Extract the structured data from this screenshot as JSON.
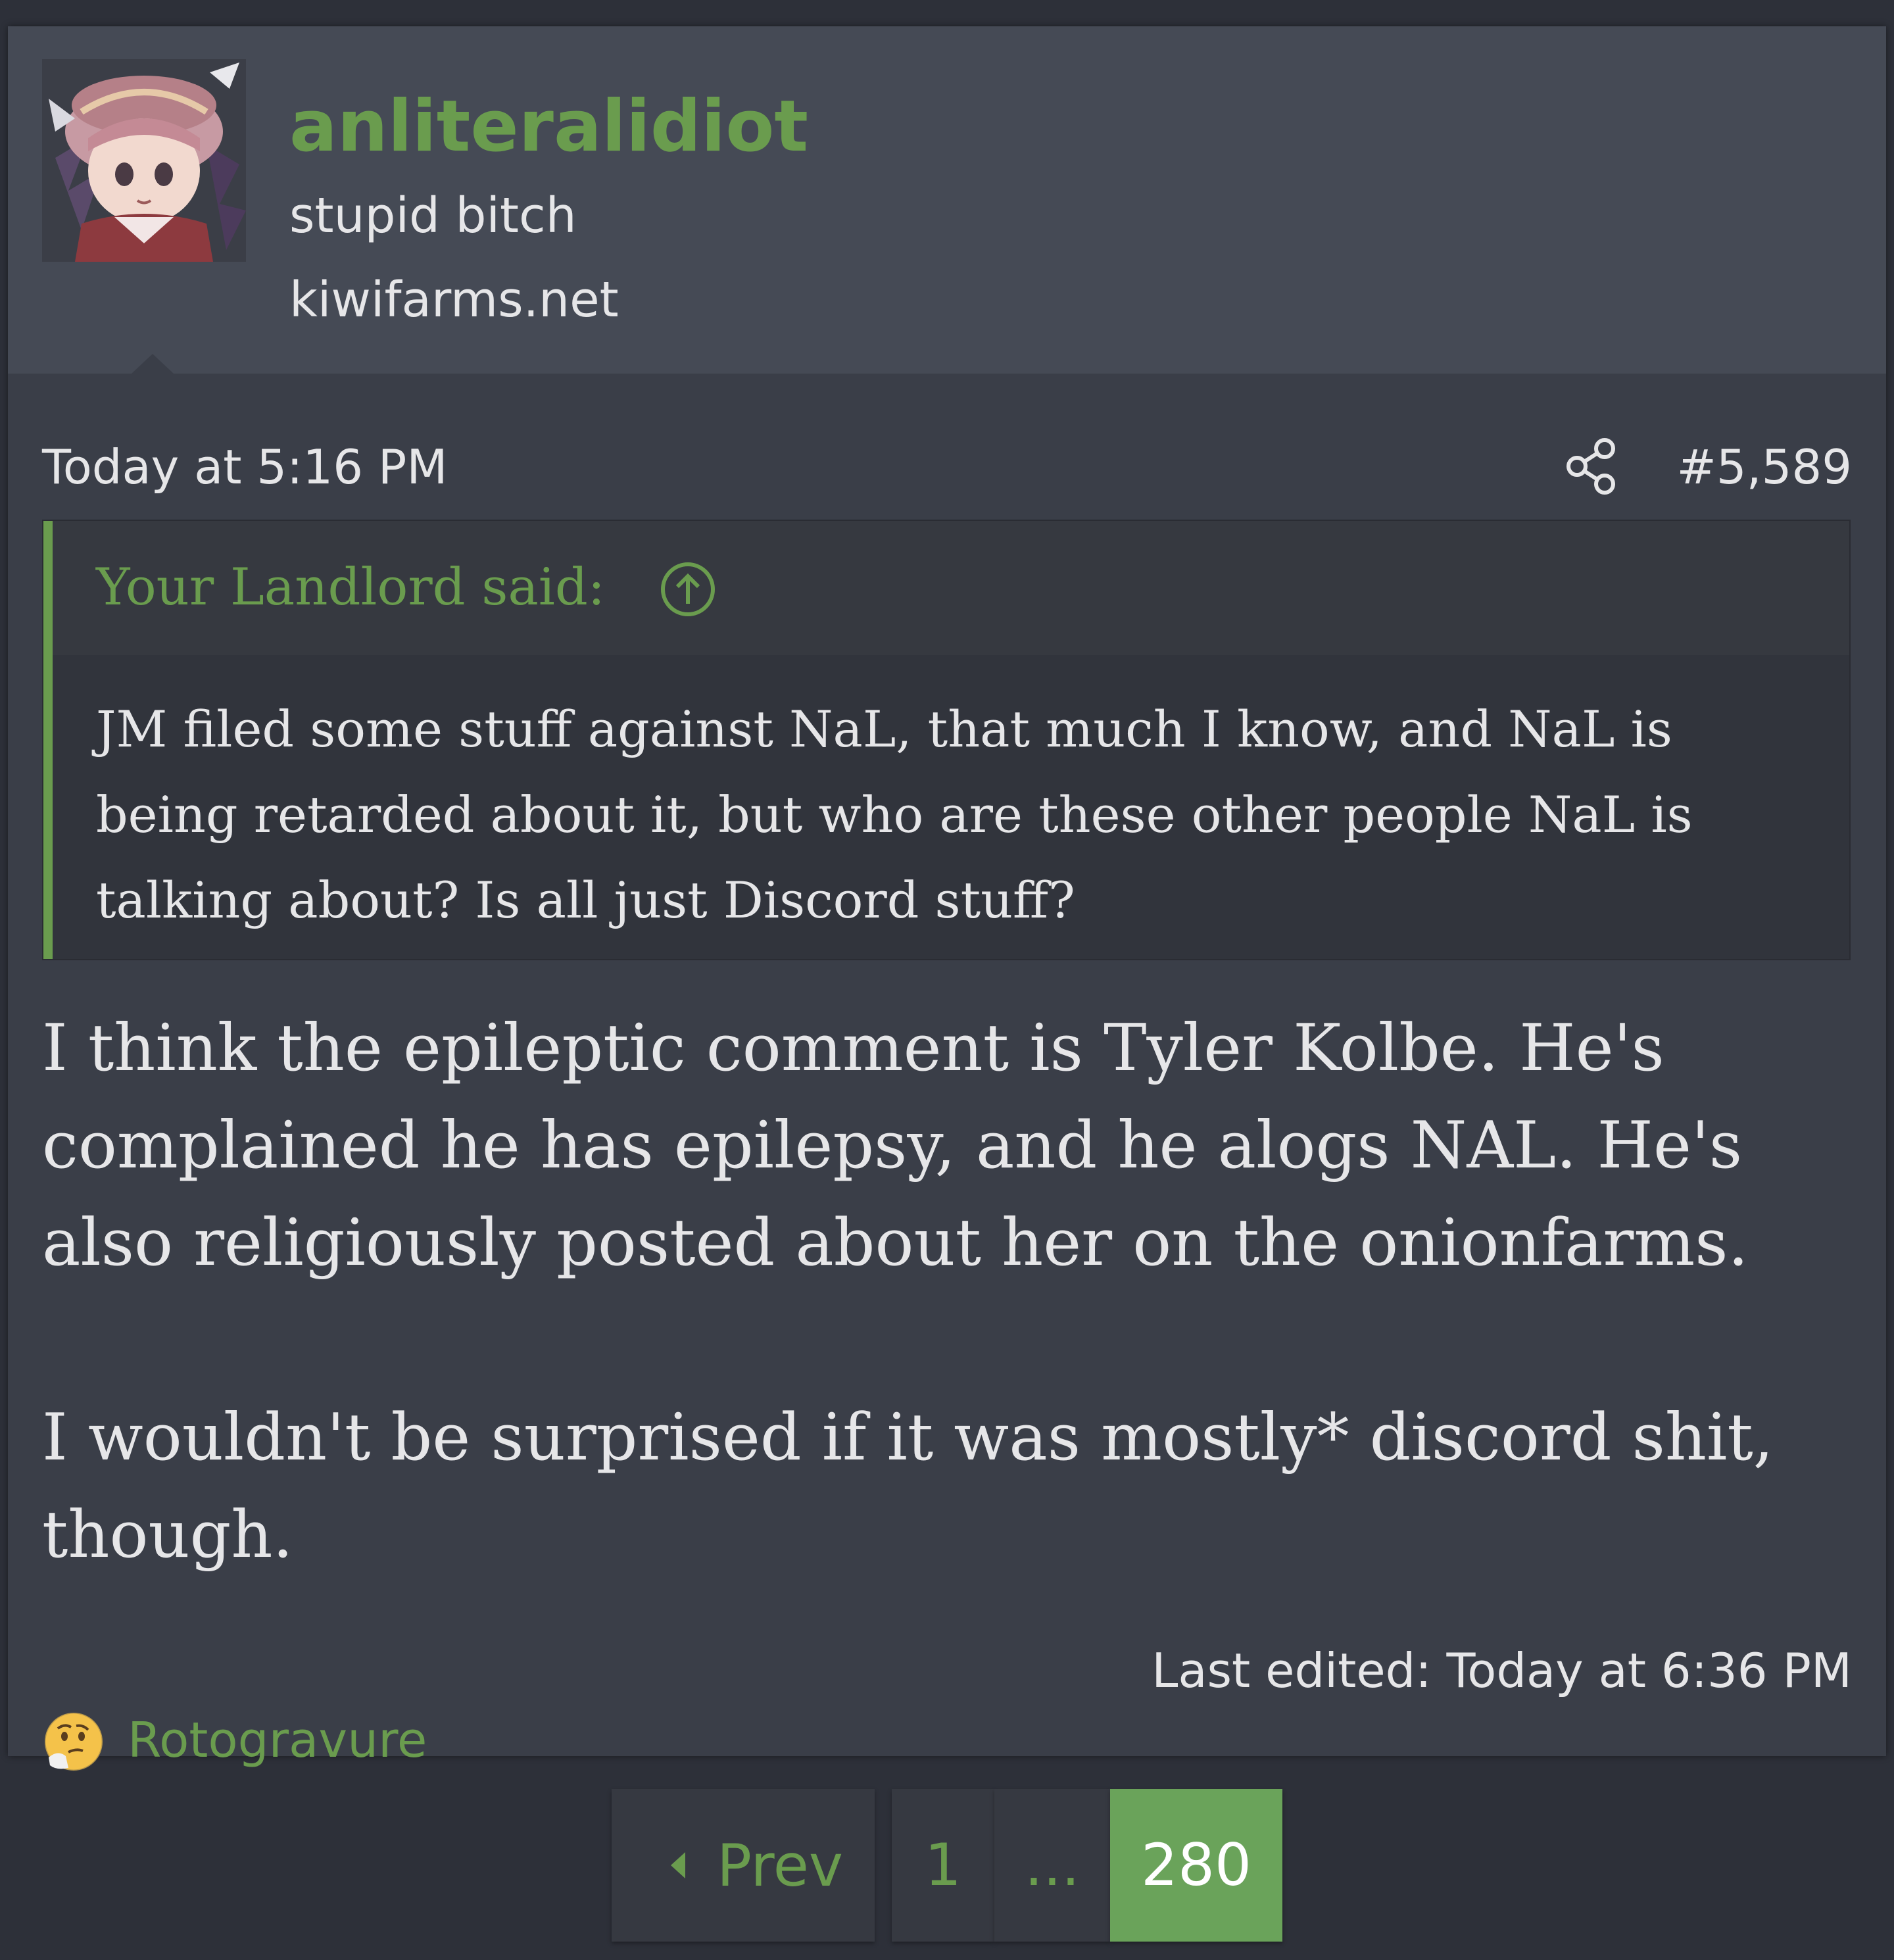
{
  "user": {
    "name": "anliteralidiot",
    "title": "stupid bitch",
    "banner": "kiwifarms.net"
  },
  "post": {
    "date": "Today at 5:16 PM",
    "number": "#5,589",
    "share_icon": "share-icon",
    "quote": {
      "author": "Your Landlord said:",
      "arrow_icon": "arrow-up-circle-icon",
      "text": "JM filed some stuff against NaL, that much I know, and NaL is being retarded about it, but who are these other people NaL is talking about? Is all just Discord stuff?"
    },
    "paragraphs": [
      "I think the epileptic comment is Tyler Kolbe. He's complained he has epilepsy, and he alogs NAL. He's also religiously posted about her on the onionfarms.",
      "I wouldn't be surprised if it was mostly* discord shit, though."
    ],
    "last_edited": "Last edited: Today at 6:36 PM",
    "reaction": {
      "emoji_icon": "thinking-face-icon",
      "user": "Rotogravure"
    }
  },
  "pagination": {
    "prev": "Prev",
    "first": "1",
    "ellipsis": "...",
    "current": "280"
  },
  "colors": {
    "accent": "#6a9c4e",
    "page_bg": "#2d3039",
    "post_bg": "#3a3e48",
    "header_bg": "#454a55",
    "text": "#e6e6e8"
  }
}
